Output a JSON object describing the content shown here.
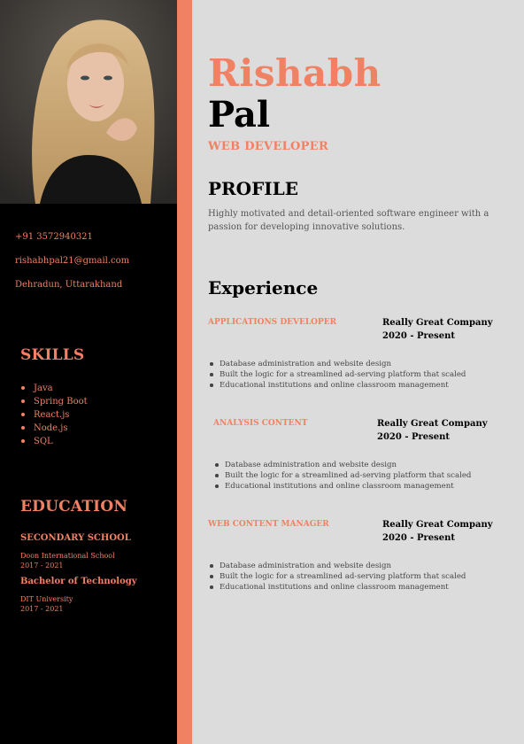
{
  "header": {
    "first_name": "Rishabh",
    "last_name": "Pal",
    "role": "WEB DEVELOPER"
  },
  "contact": {
    "phone": "+91 3572940321",
    "email": "rishabhpal21@gmail.com",
    "location": "Dehradun, Uttarakhand"
  },
  "skills": {
    "title": "SKILLS",
    "items": [
      "Java",
      "Spring Boot",
      "React.js",
      "Node.js",
      "SQL"
    ]
  },
  "education": {
    "title": "EDUCATION",
    "items": [
      {
        "degree": "SECONDARY SCHOOL",
        "school": "Doon International School",
        "years": "2017 - 2021"
      },
      {
        "degree": "Bachelor of Technology",
        "school": "DIT University",
        "years": "2017 - 2021"
      }
    ]
  },
  "profile": {
    "title": "PROFILE",
    "text": "Highly motivated and detail-oriented software engineer with a passion for developing innovative solutions."
  },
  "experience": {
    "title": "Experience",
    "jobs": [
      {
        "title": "APPLICATIONS DEVELOPER",
        "company": "Really Great Company",
        "period": "2020 - Present",
        "bullets": [
          "Database administration and website design",
          "Built the logic for a streamlined ad-serving platform that scaled",
          "Educational institutions and online classroom management"
        ]
      },
      {
        "title": "ANALYSIS CONTENT",
        "company": "Really Great Company",
        "period": "2020 - Present",
        "bullets": [
          "Database administration and website design",
          "Built the logic for a streamlined ad-serving platform that scaled",
          "Educational institutions and online classroom management"
        ]
      },
      {
        "title": "WEB CONTENT MANAGER",
        "company": "Really Great Company",
        "period": "2020 - Present",
        "bullets": [
          "Database administration and website design",
          "Built the logic for a streamlined ad-serving platform that scaled",
          "Educational institutions and online classroom management"
        ]
      }
    ]
  },
  "colors": {
    "accent": "#f08163",
    "sidebar": "#000000",
    "main_bg": "#dcdcdc"
  }
}
